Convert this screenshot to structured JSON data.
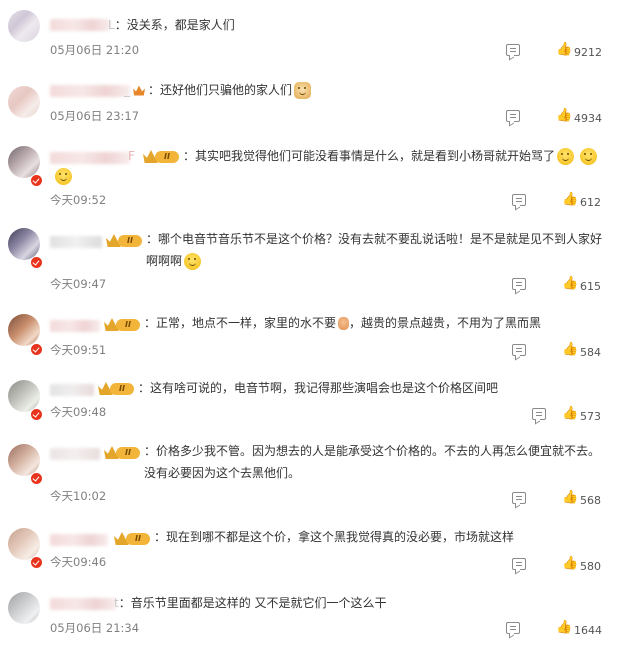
{
  "comments": [
    {
      "username_suffix": "L",
      "text": "没关系，都是家人们",
      "time": "05月06日 21:20",
      "likes": "9212",
      "emoji": ""
    },
    {
      "username_suffix": "_",
      "text": "还好他们只骗他的家人们",
      "time": "05月06日 23:17",
      "likes": "4934",
      "emoji": "doge-emoji"
    },
    {
      "username_suffix": "F",
      "level": "II",
      "text": "其实吧我觉得他们可能没看事情是什么，就是看到小杨哥就开始骂了",
      "time": "今天09:52",
      "likes": "612",
      "emoji": "smile-emoji"
    },
    {
      "username_suffix": "",
      "level": "II",
      "text": "哪个电音节音乐节不是这个价格？没有去就不要乱说话啦！是不是就是见不到人家好啊啊啊",
      "time": "今天09:47",
      "likes": "615",
      "emoji": "tongue-emoji"
    },
    {
      "username_suffix": "",
      "level": "II",
      "text_before": "正常，地点不一样，家里的水不要",
      "text_after": "，越贵的景点越贵，不用为了黑而黑",
      "time": "今天09:51",
      "likes": "584"
    },
    {
      "username_suffix": "",
      "level": "II",
      "text": "这有啥可说的，电音节啊，我记得那些演唱会也是这个价格区间吧",
      "time": "今天09:48",
      "likes": "573"
    },
    {
      "username_suffix": "",
      "level": "II",
      "text": "价格多少我不管。因为想去的人是能承受这个价格的。不去的人再怎么便宜就不去。没有必要因为这个去黑他们。",
      "time": "今天10:02",
      "likes": "568"
    },
    {
      "username_suffix": "",
      "level": "II",
      "text": "现在到哪不都是这个价，拿这个黑我觉得真的没必要，市场就这样",
      "time": "今天09:46",
      "likes": "580"
    },
    {
      "username_suffix": "t",
      "text": "音乐节里面都是这样的 又不是就它们一个这么干",
      "time": "05月06日 21:34",
      "likes": "1644"
    }
  ],
  "colon": "："
}
